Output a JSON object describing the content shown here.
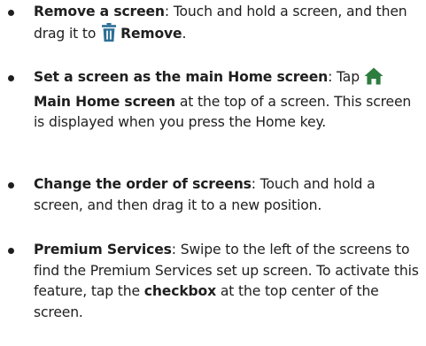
{
  "colors": {
    "text": "#1f1f1f",
    "icon_trash": "#2d6f96",
    "icon_home": "#2d7d3f"
  },
  "items": [
    {
      "term": "Remove a screen",
      "sep": ": ",
      "body_a": "Touch and hold a screen, and then drag it to ",
      "icon": "trash-icon",
      "label": "Remove",
      "end": "."
    },
    {
      "term": "Set a screen as the main Home screen",
      "sep": ": ",
      "body_a": "Tap ",
      "icon": "home-icon",
      "label": "Main Home screen",
      "body_b": " at the top of a screen. This screen is displayed when you press the Home key."
    },
    {
      "term": "Change the order of screens",
      "sep": ": ",
      "body_a": "Touch and hold a screen, and then drag it to a new position."
    },
    {
      "term": "Premium Services",
      "sep": ": ",
      "body_a": "Swipe to the left of the screens to find the Premium Services set up screen. To activate this feature, tap the ",
      "label": "checkbox",
      "body_b": " at the top center of the screen."
    }
  ]
}
